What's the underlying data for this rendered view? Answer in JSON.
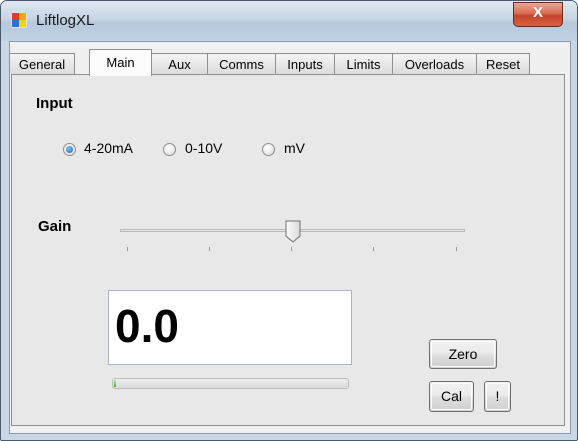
{
  "window": {
    "title": "LiftlogXL",
    "close_label": "X"
  },
  "tabs": [
    "General",
    "Main",
    "Aux",
    "Comms",
    "Inputs",
    "Limits",
    "Overloads",
    "Reset"
  ],
  "active_tab": "Main",
  "input": {
    "heading": "Input",
    "options": [
      "4-20mA",
      "0-10V",
      "mV"
    ],
    "selected": "4-20mA"
  },
  "gain": {
    "label": "Gain",
    "slider_fraction": 0.5
  },
  "reading": {
    "value": "0.0",
    "progress_fraction": 0.01
  },
  "buttons": {
    "zero": "Zero",
    "cal": "Cal",
    "exclaim": "!"
  },
  "colors": {
    "radio_selected": "#1a5ea8",
    "progress_fill": "#29c21f",
    "close_button": "#c4452c"
  }
}
